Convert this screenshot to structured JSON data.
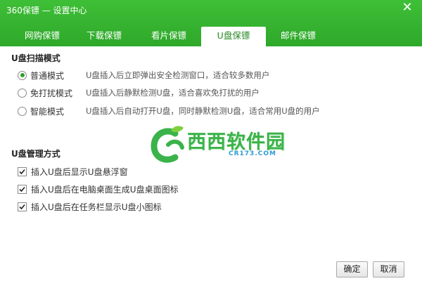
{
  "window": {
    "title": "360保镖 — 设置中心",
    "close_glyph": "✕"
  },
  "tabs": [
    {
      "label": "网购保镖",
      "active": false
    },
    {
      "label": "下载保镖",
      "active": false
    },
    {
      "label": "看片保镖",
      "active": false
    },
    {
      "label": "U盘保镖",
      "active": true
    },
    {
      "label": "邮件保镖",
      "active": false
    }
  ],
  "scan": {
    "title": "U盘扫描模式",
    "options": [
      {
        "label": "普通模式",
        "desc": "U盘插入后立即弹出安全检测窗口，适合较多数用户",
        "selected": true
      },
      {
        "label": "免打扰模式",
        "desc": "U盘插入后静默检测U盘，适合喜欢免打扰的用户",
        "selected": false
      },
      {
        "label": "智能模式",
        "desc": "U盘插入后自动打开U盘，同时静默检测U盘，适合常用U盘的用户",
        "selected": false
      }
    ]
  },
  "manage": {
    "title": "U盘管理方式",
    "options": [
      {
        "label": "插入U盘后显示U盘悬浮窗",
        "checked": true
      },
      {
        "label": "插入U盘后在电脑桌面生成U盘桌面图标",
        "checked": true
      },
      {
        "label": "插入U盘后在任务栏显示U盘小图标",
        "checked": true
      }
    ]
  },
  "watermark": {
    "main": "西西软件园",
    "sub": "CR173.COM",
    "color": "#3bb34a"
  },
  "buttons": {
    "ok": "确定",
    "cancel": "取消"
  },
  "colors": {
    "brand_green": "#2ea82a",
    "active_tab_text": "#2a8a25"
  }
}
